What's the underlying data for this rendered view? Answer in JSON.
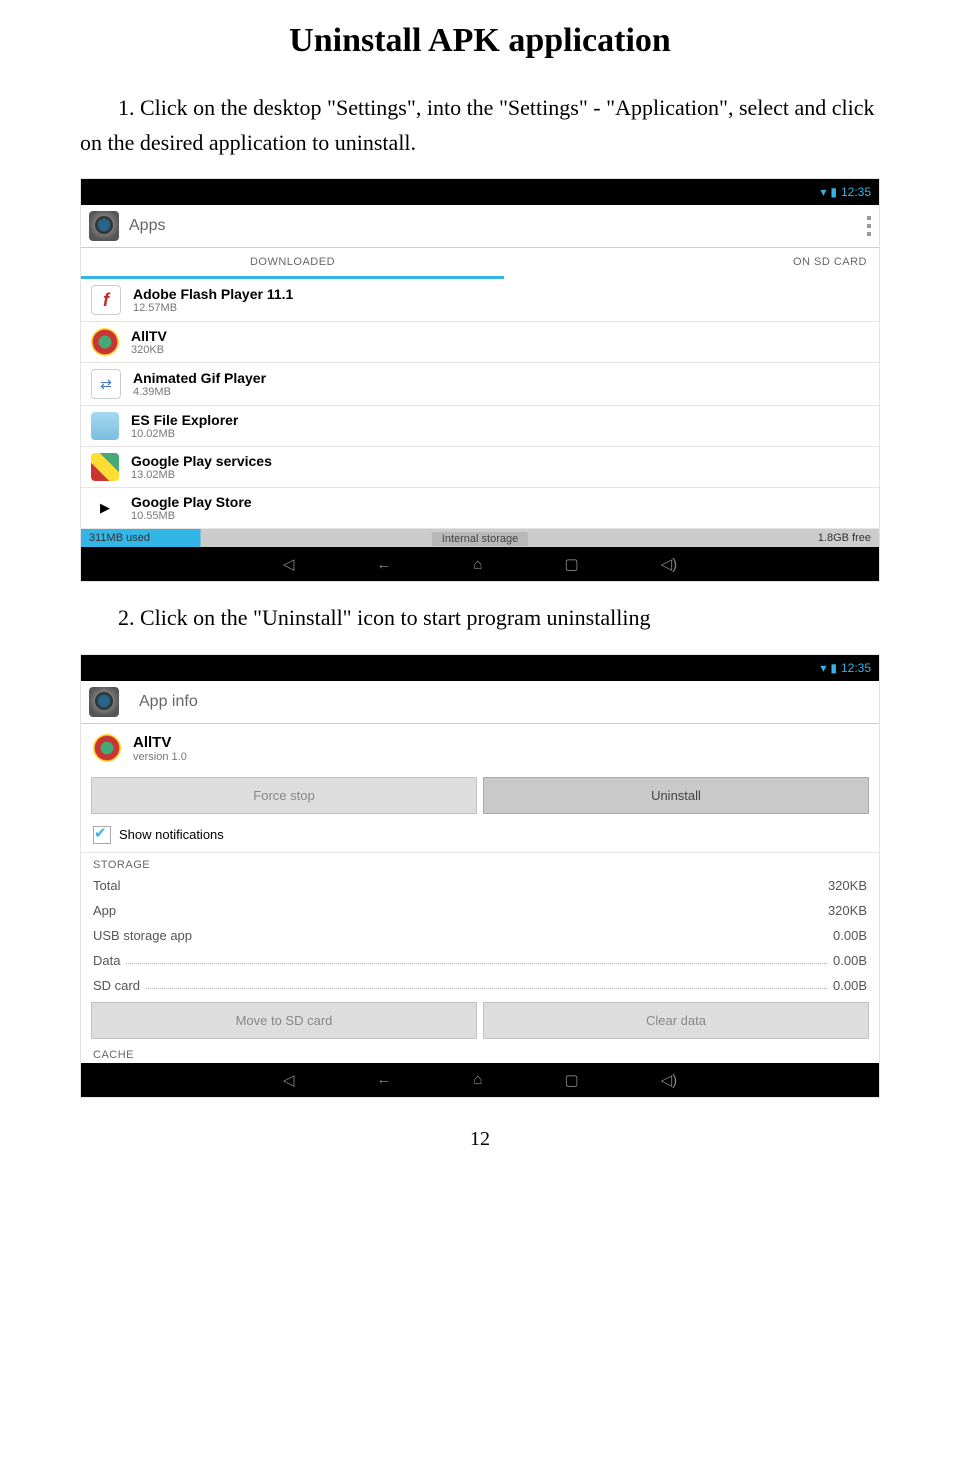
{
  "doc": {
    "title": "Uninstall APK application",
    "para1": "1. Click on the desktop \"Settings\", into the \"Settings\" - \"Application\", select and click on the desired application to uninstall.",
    "para2": "2. Click on the \"Uninstall\" icon to start program uninstalling",
    "page": "12"
  },
  "status": {
    "wifi": "▾",
    "batt": "▮",
    "time": "12:35"
  },
  "shot1": {
    "headerTitle": "Apps",
    "tabActive": "DOWNLOADED",
    "tabRight": "ON SD CARD",
    "apps": [
      {
        "name": "Adobe Flash Player 11.1",
        "size": "12.57MB"
      },
      {
        "name": "AllTV",
        "size": "320KB"
      },
      {
        "name": "Animated Gif Player",
        "size": "4.39MB"
      },
      {
        "name": "ES File Explorer",
        "size": "10.02MB"
      },
      {
        "name": "Google Play services",
        "size": "13.02MB"
      },
      {
        "name": "Google Play Store",
        "size": "10.55MB"
      }
    ],
    "storageUsed": "311MB used",
    "storageMid": "Internal storage",
    "storageFree": "1.8GB free"
  },
  "shot2": {
    "headerTitle": "App info",
    "appName": "AllTV",
    "appVer": "version 1.0",
    "btnForce": "Force stop",
    "btnUninstall": "Uninstall",
    "showNotif": "Show notifications",
    "storageLabel": "STORAGE",
    "rows": [
      {
        "k": "Total",
        "v": "320KB"
      },
      {
        "k": "App",
        "v": "320KB"
      },
      {
        "k": "USB storage app",
        "v": "0.00B"
      },
      {
        "k": "Data",
        "v": "0.00B"
      },
      {
        "k": "SD card",
        "v": "0.00B"
      }
    ],
    "btnMove": "Move to SD card",
    "btnClear": "Clear data",
    "cacheLabel": "CACHE"
  },
  "nav": {
    "vd": "◁",
    "back": "←",
    "home": "⌂",
    "recent": "▢",
    "vol": "◁)"
  }
}
